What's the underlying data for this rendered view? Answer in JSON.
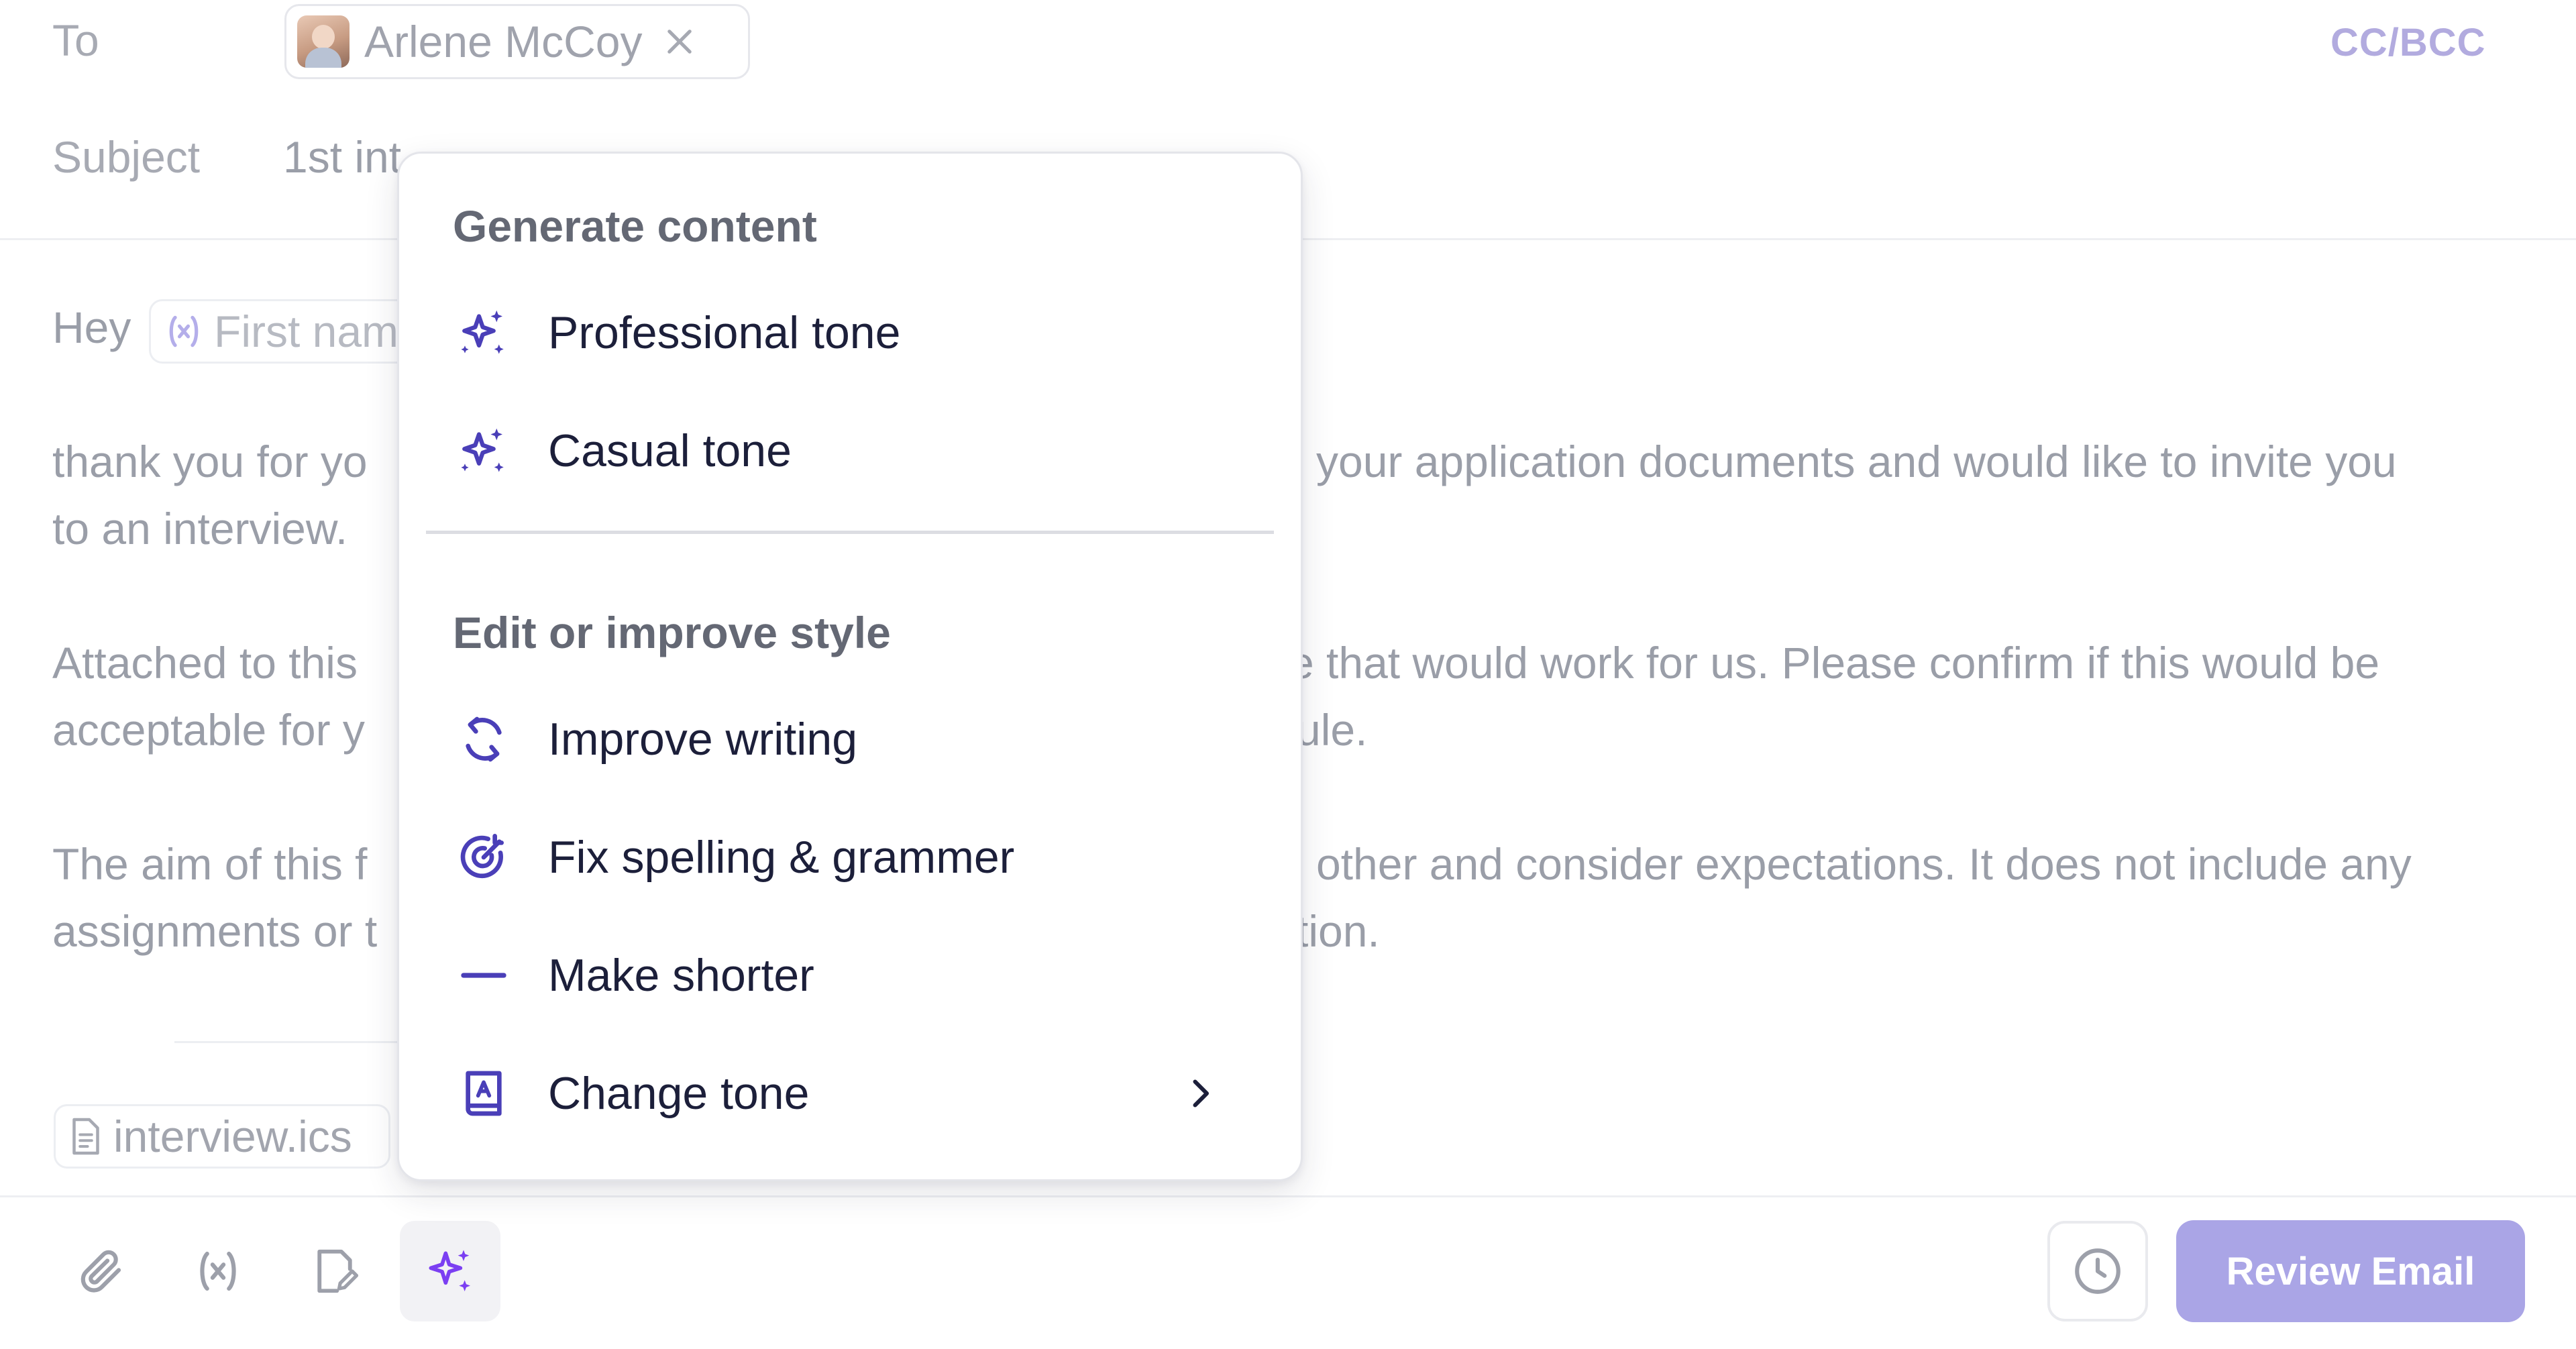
{
  "header": {
    "to_label": "To",
    "recipient_name": "Arlene McCoy",
    "cc_bcc": "CC/BCC",
    "subject_label": "Subject",
    "subject_visible": "1st int"
  },
  "body": {
    "greeting": "Hey",
    "variable_placeholder": "First nam",
    "para1_line1_left": "thank you for yo",
    "para1_line1_right": "your application documents and would like to invite you",
    "para1_line2_left": "to an interview.",
    "para2_line1_left": "Attached to this",
    "para2_line1_right": "e that would work for us. Please confirm if this would be",
    "para2_line2_left": "acceptable for y",
    "para2_line2_right": "ule.",
    "para3_line1_left": "The aim of this f",
    "para3_line1_right": "other and consider expectations. It does not include any",
    "para3_line2_left": "assignments or t",
    "para3_line2_right": "tion.",
    "attachment_name": "interview.ics"
  },
  "menu": {
    "section1_title": "Generate content",
    "section1_items": [
      {
        "label": "Professional tone",
        "icon": "sparkles-icon"
      },
      {
        "label": "Casual tone",
        "icon": "sparkles-icon"
      }
    ],
    "section2_title": "Edit or improve style",
    "section2_items": [
      {
        "label": "Improve writing",
        "icon": "refresh-icon"
      },
      {
        "label": "Fix spelling & grammer",
        "icon": "target-icon"
      },
      {
        "label": "Make shorter",
        "icon": "minus-icon"
      },
      {
        "label": "Change tone",
        "icon": "book-icon",
        "has_submenu": true
      }
    ]
  },
  "toolbar": {
    "tools": [
      "paperclip-icon",
      "variable-icon",
      "edit-document-icon",
      "sparkles-icon"
    ],
    "active_tool": "sparkles-icon",
    "history_icon": "clock-icon",
    "review_label": "Review Email"
  },
  "colors": {
    "accent": "#4a3fb8",
    "accent_light": "#aaa5e6",
    "active_sparkle": "#7b3ff2",
    "muted_text": "#9a9ea8"
  }
}
